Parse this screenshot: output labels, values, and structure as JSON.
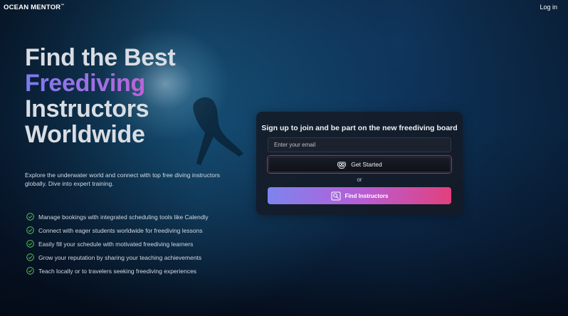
{
  "header": {
    "logo": "OCEAN MENTOR",
    "logo_mark": "™",
    "login_label": "Log in"
  },
  "hero": {
    "line1": "Find the Best",
    "line2": "Freediving",
    "line3": "Instructors",
    "line4": "Worldwide"
  },
  "intro": "Explore the underwater world and connect with top free diving instructors globally. Dive into expert training.",
  "features": [
    "Manage bookings with integrated scheduling tools like Calendly",
    "Connect with eager students worldwide for freediving lessons",
    "Easily fill your schedule with motivated freediving learners",
    "Grow your reputation by sharing your teaching achievements",
    "Teach locally or to travelers seeking freediving experiences"
  ],
  "signup": {
    "title": "Sign up to join and be part on the new freediving board",
    "email_placeholder": "Enter your email",
    "email_value": "",
    "get_started_label": "Get Started",
    "get_started_icon": "diver-mask-icon",
    "or_label": "or",
    "find_label": "Find Instructors",
    "find_icon": "search-instructor-icon"
  },
  "colors": {
    "check": "#4caf50",
    "gradient_start": "#7d84ef",
    "gradient_mid": "#b55fd6",
    "gradient_end": "#e2407e"
  }
}
